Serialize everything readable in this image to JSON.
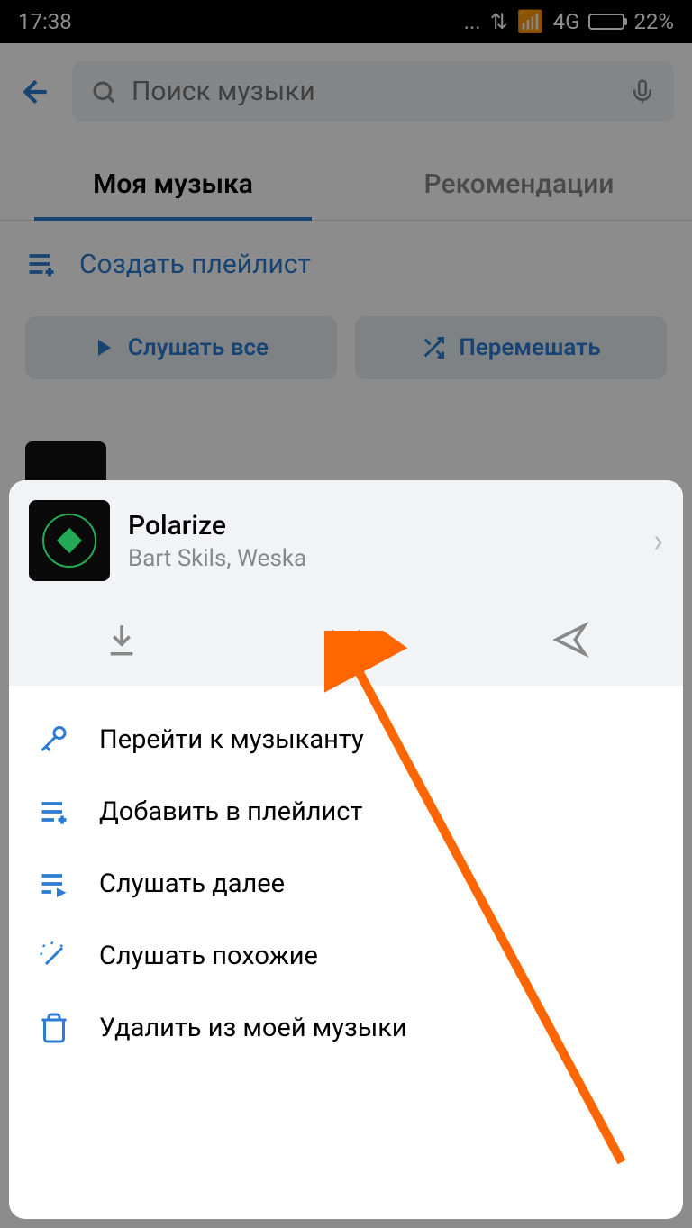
{
  "statusbar": {
    "time": "17:38",
    "network": "4G",
    "battery": "22%"
  },
  "header": {
    "search_placeholder": "Поиск музыки"
  },
  "tabs": {
    "my_music": "Моя музыка",
    "recommendations": "Рекомендации"
  },
  "create_playlist_label": "Создать плейлист",
  "buttons": {
    "play_all": "Слушать все",
    "shuffle": "Перемешать"
  },
  "sheet": {
    "track": {
      "title": "Polarize",
      "artist": "Bart Skils, Weska"
    },
    "menu": {
      "go_to_artist": "Перейти к музыканту",
      "add_to_playlist": "Добавить в плейлист",
      "play_next": "Слушать далее",
      "similar": "Слушать похожие",
      "delete": "Удалить из моей музыки"
    }
  }
}
